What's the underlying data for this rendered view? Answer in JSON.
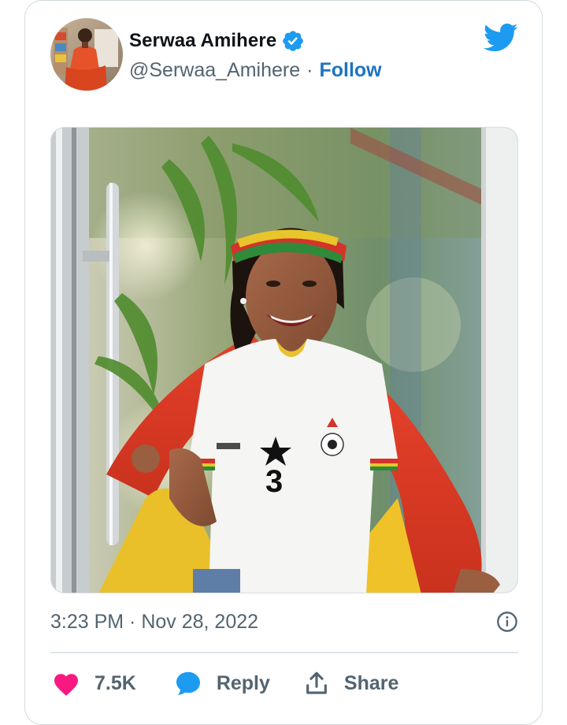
{
  "tweet": {
    "author": {
      "display_name": "Serwaa Amihere",
      "handle": "@Serwaa_Amihere",
      "verified": true
    },
    "separator": "·",
    "follow_label": "Follow",
    "timestamp": "3:23 PM · Nov 28, 2022",
    "actions": {
      "like_count": "7.5K",
      "reply_label": "Reply",
      "share_label": "Share"
    }
  },
  "icons": {
    "brand": "twitter-bird-icon",
    "verified": "verified-badge-icon",
    "info": "info-icon",
    "like": "heart-icon",
    "reply": "speech-bubble-icon",
    "share": "share-upload-icon"
  },
  "colors": {
    "brand_blue": "#1d9bf0",
    "follow_blue": "#1d73c3",
    "like_pink": "#f91880",
    "text_primary": "#0f1419",
    "text_secondary": "#536471",
    "border": "#cfd9de"
  }
}
